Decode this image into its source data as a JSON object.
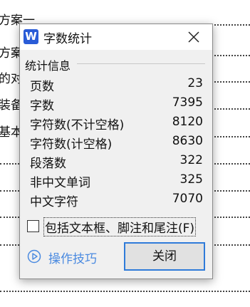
{
  "background": {
    "fragments": [
      "方案一",
      "方案",
      "的对",
      "装备",
      "基本"
    ]
  },
  "dialog": {
    "title": "字数统计",
    "app_icon_letter": "W",
    "group_title": "统计信息",
    "stats": [
      {
        "label": "页数",
        "value": "23"
      },
      {
        "label": "字数",
        "value": "7395"
      },
      {
        "label": "字符数(不计空格)",
        "value": "8120"
      },
      {
        "label": "字符数(计空格)",
        "value": "8630"
      },
      {
        "label": "段落数",
        "value": "322"
      },
      {
        "label": "非中文单词",
        "value": "325"
      },
      {
        "label": "中文字符",
        "value": "7070"
      }
    ],
    "checkbox_label": "包括文本框、脚注和尾注(F)",
    "checkbox_checked": false,
    "tips_label": "操作技巧",
    "close_button_label": "关闭",
    "colors": {
      "accent": "#2f7bd9",
      "link": "#4a8ae0",
      "app_icon": "#2a5cd7"
    }
  }
}
